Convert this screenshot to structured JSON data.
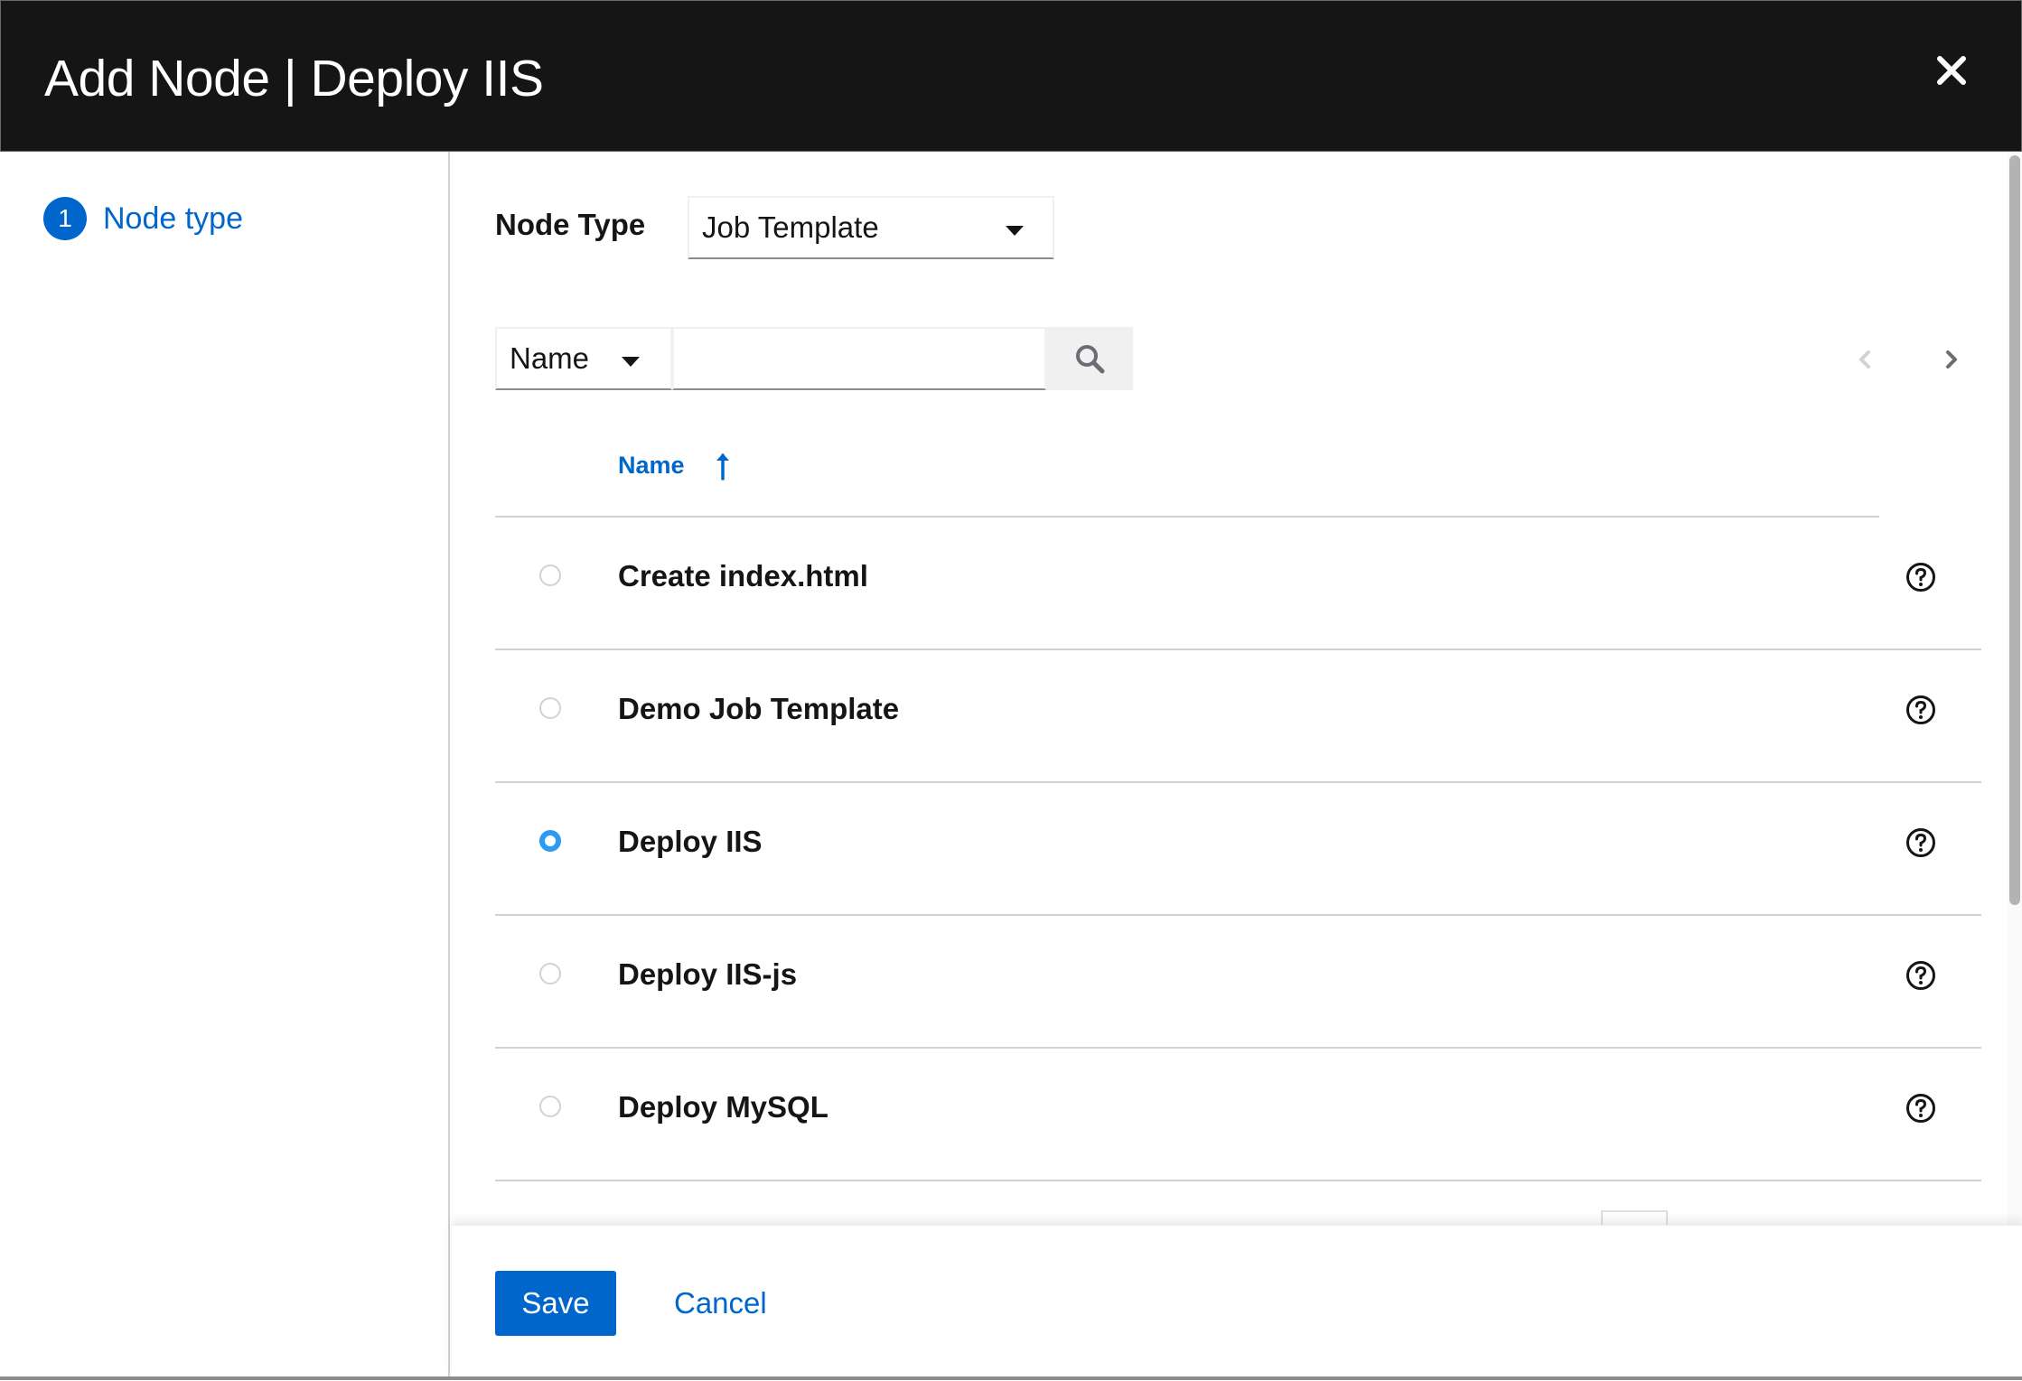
{
  "modal": {
    "title": "Add Node | Deploy IIS"
  },
  "wizard": {
    "steps": [
      {
        "number": "1",
        "label": "Node type",
        "active": true
      }
    ]
  },
  "form": {
    "node_type_label": "Node Type",
    "node_type_value": "Job Template"
  },
  "toolbar": {
    "filter_attribute": "Name",
    "search_value": "",
    "search_placeholder": ""
  },
  "table": {
    "column_name": "Name",
    "sort_direction": "ascending",
    "rows": [
      {
        "name": "Create index.html",
        "selected": false
      },
      {
        "name": "Demo Job Template",
        "selected": false
      },
      {
        "name": "Deploy IIS",
        "selected": true
      },
      {
        "name": "Deploy IIS-js",
        "selected": false
      },
      {
        "name": "Deploy MySQL",
        "selected": false
      }
    ]
  },
  "footer": {
    "save_label": "Save",
    "cancel_label": "Cancel"
  },
  "icons": {
    "close": "close-icon",
    "search": "search-icon",
    "prev": "chevron-left-icon",
    "next": "chevron-right-icon",
    "sort": "arrow-up-icon",
    "help": "question-circle-icon",
    "dropdown": "caret-down-icon"
  },
  "colors": {
    "header_bg": "#151515",
    "accent": "#0066cc",
    "radio_selected": "#2b9af3"
  }
}
